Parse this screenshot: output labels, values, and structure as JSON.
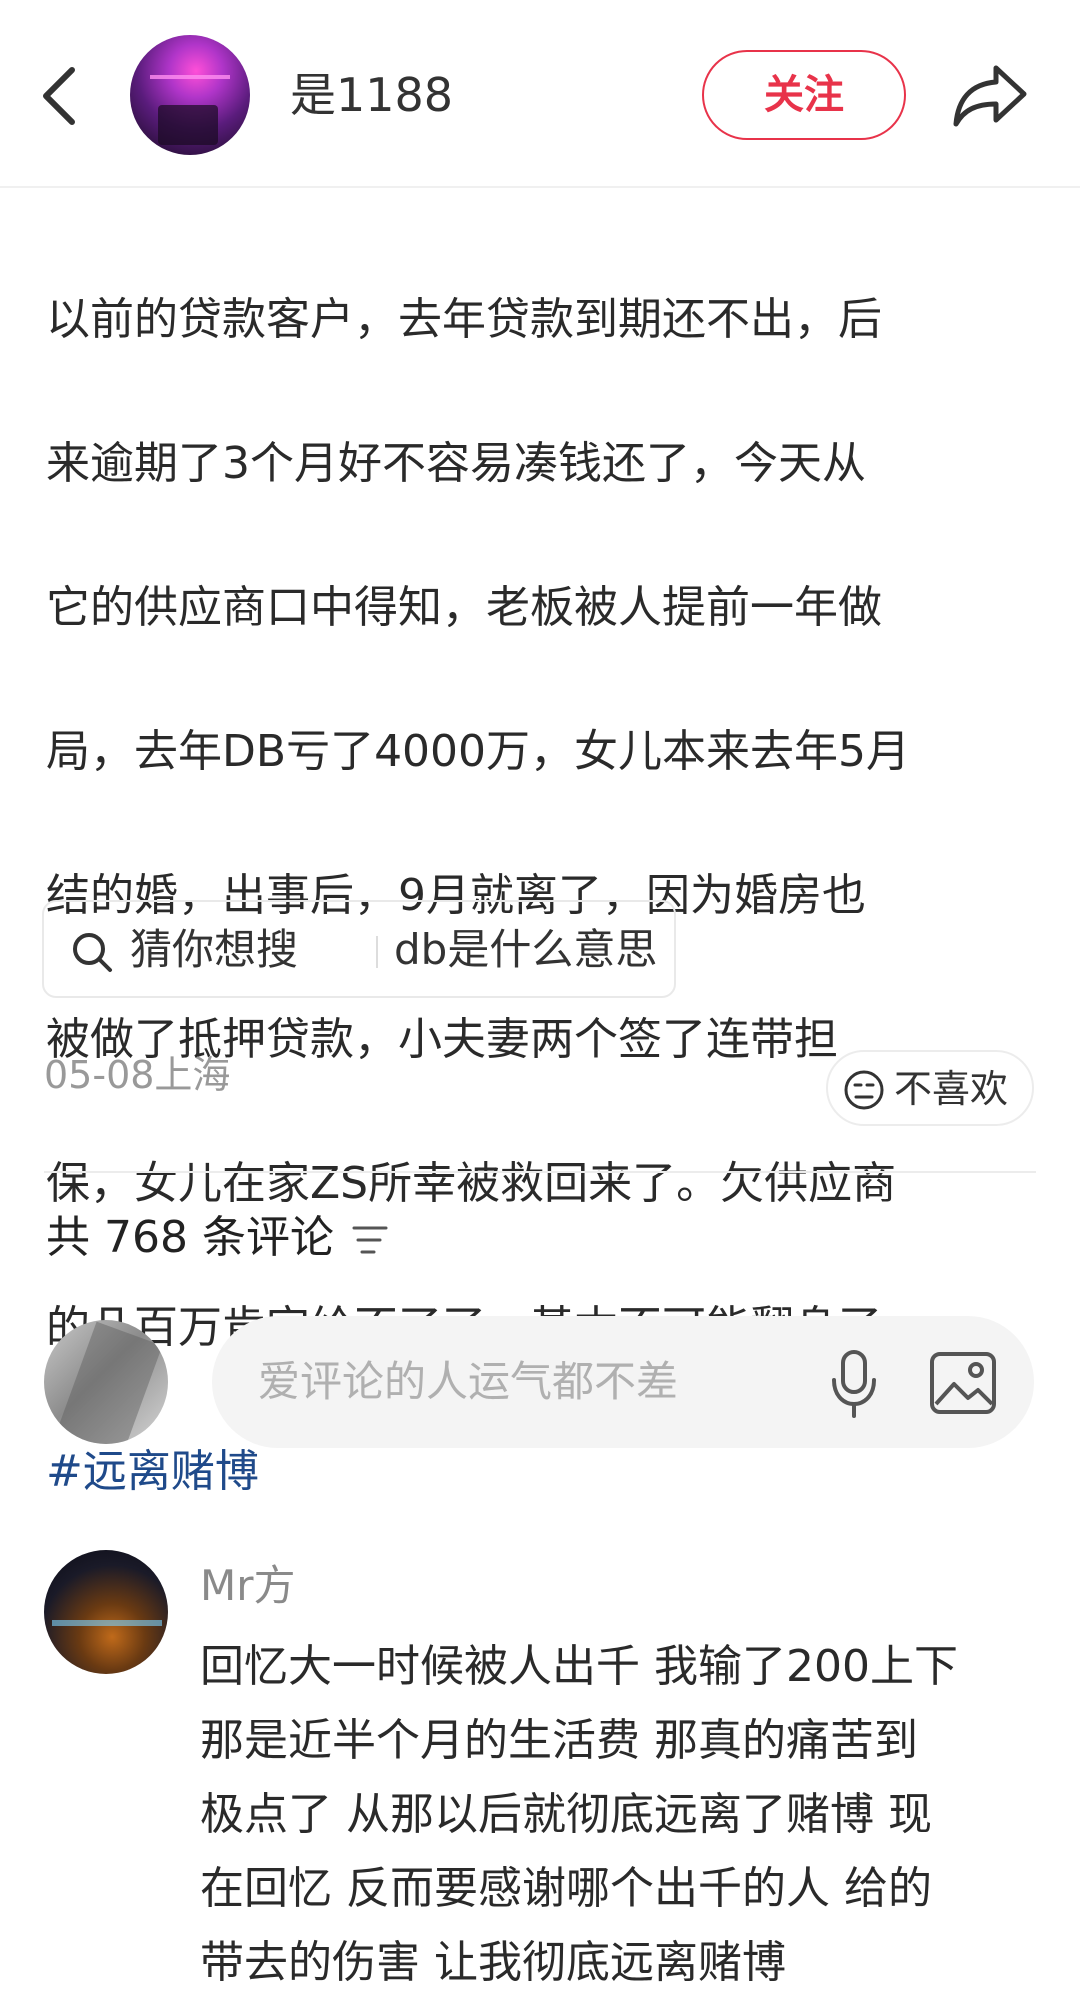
{
  "header": {
    "author_name": "是1188",
    "follow_label": "关注"
  },
  "post": {
    "lines": [
      "以前的贷款客户，去年贷款到期还不出，后",
      "来逾期了3个月好不容易凑钱还了，今天从",
      "它的供应商口中得知，老板被人提前一年做",
      "局，去年DB亏了4000万，女儿本来去年5月",
      "结的婚，出事后，9月就离了，因为婚房也",
      "被做了抵押贷款，小夫妻两个签了连带担",
      "保，女儿在家ZS所幸被救回来了。欠供应商",
      "的几百万肯定给不了了，基本不可能翻身了"
    ],
    "hashtag": "#远离赌博",
    "search_chip": {
      "label": "猜你想搜",
      "query": "db是什么意思"
    },
    "meta": "05-08上海",
    "dislike_label": "不喜欢"
  },
  "comments_section": {
    "count_label": "共 768 条评论",
    "input_placeholder": "爱评论的人运气都不差",
    "comments": [
      {
        "author": "Mr方",
        "lines": [
          "回忆大一时候被人出千  我输了200上下",
          "那是近半个月的生活费  那真的痛苦到",
          "极点了  从那以后就彻底远离了赌博  现",
          "在回忆 反而要感谢哪个出千的人  给的",
          "带去的伤害 让我彻底远离赌博"
        ]
      }
    ]
  },
  "colors": {
    "accent_red": "#e8334a",
    "hashtag_blue": "#1f4a8a",
    "meta_gray": "#999999"
  },
  "icons": [
    "back-icon",
    "share-icon",
    "search-icon",
    "dislike-face-icon",
    "sort-icon",
    "microphone-icon",
    "image-icon"
  ]
}
